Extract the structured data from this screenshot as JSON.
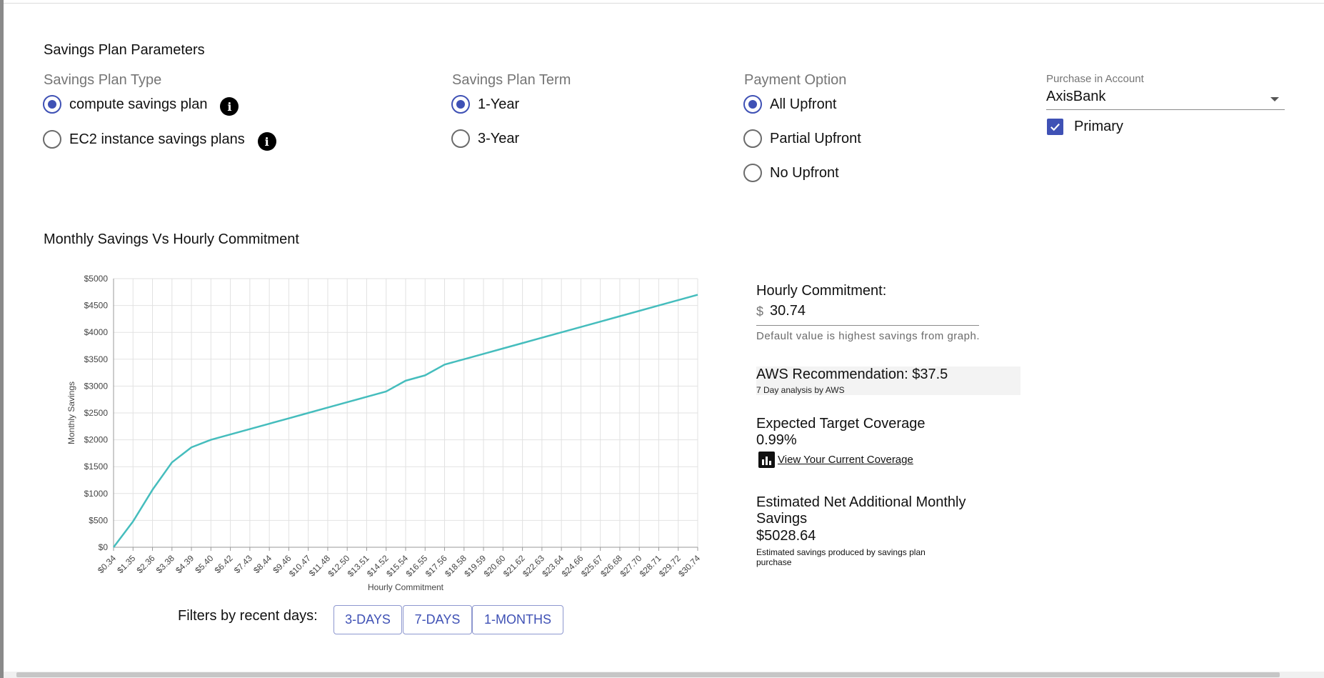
{
  "parameters": {
    "title": "Savings Plan Parameters",
    "plan_type": {
      "label": "Savings Plan Type",
      "options": [
        {
          "label": "compute savings plan",
          "selected": true
        },
        {
          "label": "EC2 instance savings plans",
          "selected": false
        }
      ]
    },
    "term": {
      "label": "Savings Plan Term",
      "options": [
        {
          "label": "1-Year",
          "selected": true
        },
        {
          "label": "3-Year",
          "selected": false
        }
      ]
    },
    "payment": {
      "label": "Payment Option",
      "options": [
        {
          "label": "All Upfront",
          "selected": true
        },
        {
          "label": "Partial Upfront",
          "selected": false
        },
        {
          "label": "No Upfront",
          "selected": false
        }
      ]
    },
    "account": {
      "label": "Purchase in Account",
      "value": "AxisBank",
      "checkbox_label": "Primary",
      "checked": true
    }
  },
  "chart_section": {
    "title": "Monthly Savings Vs Hourly Commitment"
  },
  "chart_data": {
    "type": "line",
    "title": "",
    "xlabel": "Hourly Commitment",
    "ylabel": "Monthly Savings",
    "ylim": [
      0,
      5000
    ],
    "yticks": [
      "$0",
      "$500",
      "$1000",
      "$1500",
      "$2000",
      "$2500",
      "$3000",
      "$3500",
      "$4000",
      "$4500",
      "$5000"
    ],
    "grid": true,
    "line_color": "#45bdbd",
    "categories": [
      "$0.34",
      "$1.35",
      "$2.36",
      "$3.38",
      "$4.39",
      "$5.40",
      "$6.42",
      "$7.43",
      "$8.44",
      "$9.46",
      "$10.47",
      "$11.48",
      "$12.50",
      "$13.51",
      "$14.52",
      "$15.54",
      "$16.55",
      "$17.56",
      "$18.58",
      "$19.59",
      "$20.60",
      "$21.62",
      "$22.63",
      "$23.64",
      "$24.66",
      "$25.67",
      "$26.68",
      "$27.70",
      "$28.71",
      "$29.72",
      "$30.74"
    ],
    "values": [
      0,
      480,
      1070,
      1580,
      1860,
      2000,
      2100,
      2200,
      2300,
      2400,
      2500,
      2600,
      2700,
      2800,
      2900,
      3100,
      3200,
      3400,
      3500,
      3600,
      3700,
      3800,
      3900,
      4000,
      4100,
      4200,
      4300,
      4400,
      4500,
      4600,
      4700
    ]
  },
  "sidebar": {
    "hourly_commitment": {
      "label": "Hourly Commitment:",
      "prefix": "$",
      "value": "30.74",
      "helper": "Default value is highest savings from graph."
    },
    "aws_recommendation": {
      "title": "AWS Recommendation: $37.5",
      "subtitle": "7 Day analysis by AWS"
    },
    "coverage": {
      "title": "Expected Target Coverage",
      "value": "0.99%",
      "link": "View Your Current Coverage"
    },
    "net_savings": {
      "title": "Estimated Net Additional Monthly Savings",
      "value": "$5028.64",
      "note": "Estimated savings produced by savings plan purchase"
    }
  },
  "filters": {
    "label": "Filters by recent days:",
    "buttons": [
      "3-DAYS",
      "7-DAYS",
      "1-MONTHS"
    ]
  },
  "colors": {
    "accent": "#3f51b5",
    "line": "#45bdbd"
  }
}
